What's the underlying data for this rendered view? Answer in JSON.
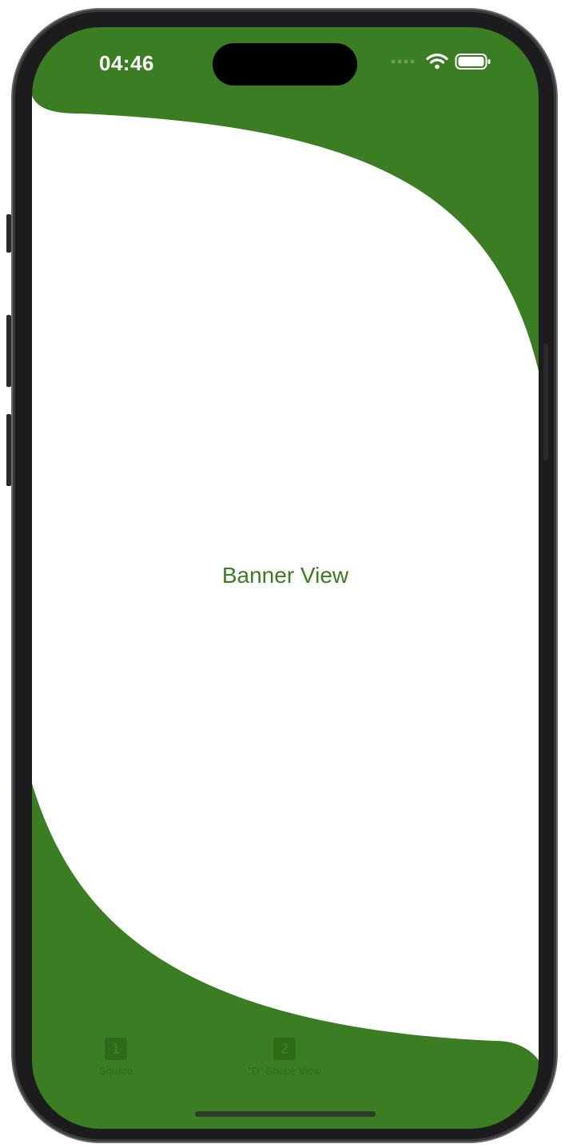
{
  "status_bar": {
    "time": "04:46"
  },
  "main": {
    "title": "Banner View"
  },
  "tab_bar": {
    "items": [
      {
        "icon_text": "1",
        "label": "Square",
        "icon": "square-1-icon"
      },
      {
        "icon_text": "2",
        "label": "\"D\" Shape View",
        "icon": "square-2-icon"
      }
    ]
  },
  "colors": {
    "accent": "#3a7d22",
    "background": "#ffffff"
  }
}
